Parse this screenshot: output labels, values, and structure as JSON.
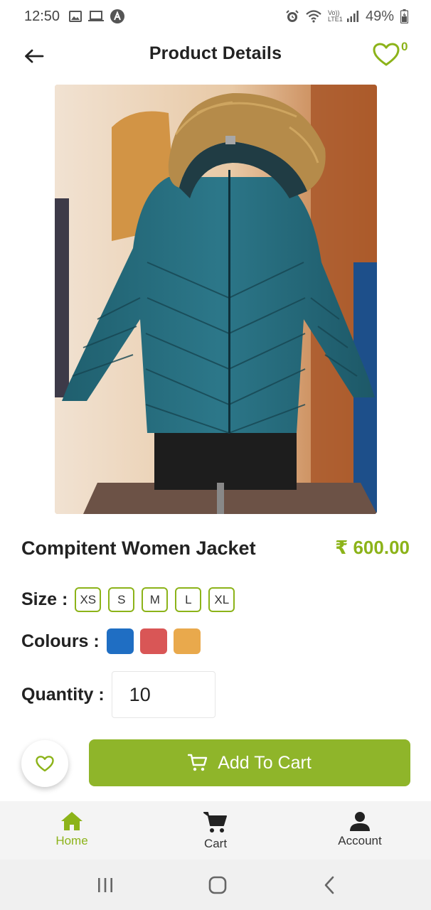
{
  "status_bar": {
    "time": "12:50",
    "battery": "49%",
    "carrier_label": "Vo)) LTE1",
    "icons": [
      "gallery-icon",
      "laptop-icon",
      "app-a-icon",
      "alarm-icon",
      "wifi-icon",
      "signal-icon",
      "battery-icon"
    ]
  },
  "header": {
    "title": "Product Details",
    "wishlist_count": "0"
  },
  "product": {
    "name": "Compitent Women Jacket",
    "price": "₹ 600.00",
    "image": "teal quilted puffer jacket with fur-trimmed hood on mannequin"
  },
  "size": {
    "label": "Size :",
    "options": [
      "XS",
      "S",
      "M",
      "L",
      "XL"
    ]
  },
  "colours": {
    "label": "Colours :",
    "swatches": [
      "#1f6ec3",
      "#d95656",
      "#e9a94c"
    ]
  },
  "quantity": {
    "label": "Quantity :",
    "value": "10"
  },
  "actions": {
    "add_to_cart_label": "Add To Cart"
  },
  "bottom_nav": {
    "items": [
      {
        "label": "Home",
        "icon": "home-icon",
        "active": true
      },
      {
        "label": "Cart",
        "icon": "cart-icon",
        "active": false
      },
      {
        "label": "Account",
        "icon": "account-icon",
        "active": false
      }
    ]
  },
  "colors": {
    "accent": "#8cb319",
    "button": "#8fb52a"
  }
}
